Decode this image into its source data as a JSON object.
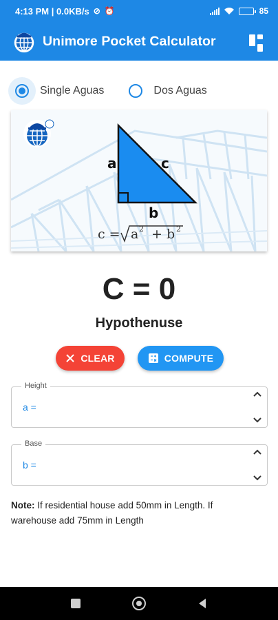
{
  "status_bar": {
    "time_speed": "4:13 PM | 0.0KB/s",
    "battery": "85",
    "battery_level": 0.85
  },
  "app_bar": {
    "title": "Unimore Pocket Calculator",
    "menu_icon": "dashboard-grid-icon",
    "logo_icon": "company-globe-logo"
  },
  "mode": {
    "options": [
      {
        "label": "Single Aguas",
        "selected": true
      },
      {
        "label": "Dos Aguas",
        "selected": false
      }
    ]
  },
  "diagram": {
    "side_a": "a",
    "side_b": "b",
    "side_c": "c",
    "formula": {
      "lhs": "c =",
      "a": "a",
      "plus": "+",
      "b": "b",
      "exp": "2"
    }
  },
  "result": {
    "value": "C = 0",
    "label": "Hypothenuse"
  },
  "buttons": {
    "clear": "CLEAR",
    "compute": "COMPUTE"
  },
  "fields": {
    "height": {
      "label": "Height",
      "prefix": "a ="
    },
    "base": {
      "label": "Base",
      "prefix": "b ="
    }
  },
  "note": {
    "label": "Note:",
    "text": " If residential house add 50mm in Length. If warehouse add 75mm in Length"
  },
  "colors": {
    "primary": "#1e88e5",
    "clear": "#f44336",
    "compute": "#2196f3",
    "triangle": "#1a8cf0"
  }
}
